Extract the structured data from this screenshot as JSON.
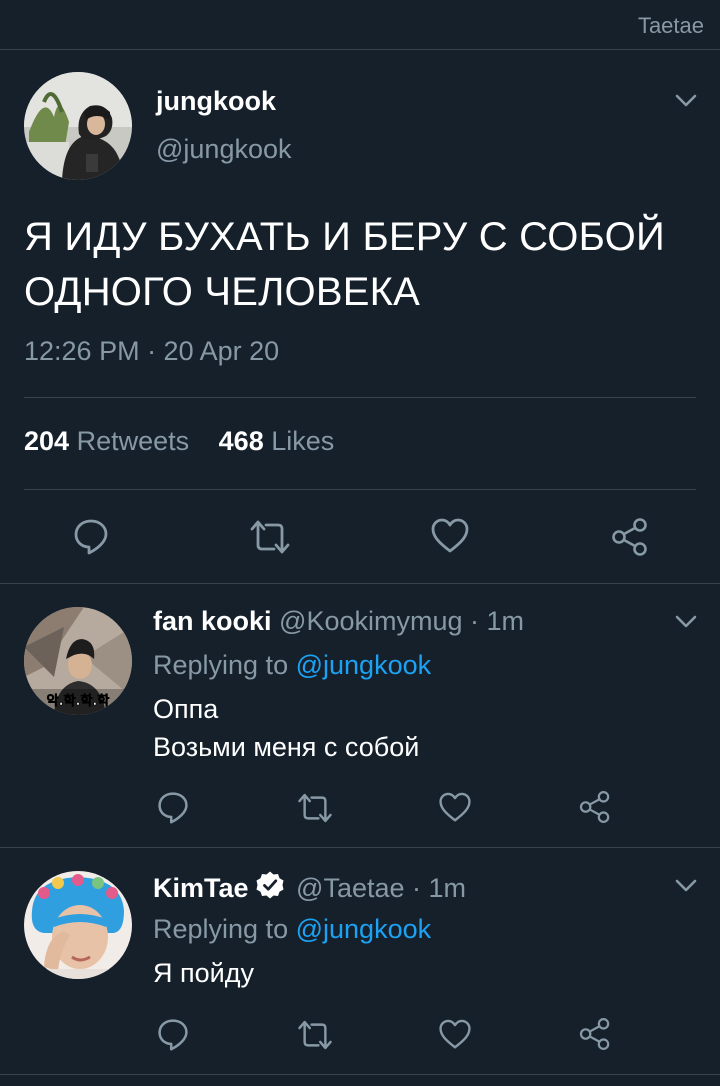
{
  "header": {
    "title": "Taetae"
  },
  "tweet": {
    "name": "jungkook",
    "handle": "@jungkook",
    "text_line1": "Я ИДУ БУХАТЬ И БЕРУ С СОБОЙ",
    "text_line2": "ОДНОГО ЧЕЛОВЕКА",
    "timestamp": "12:26 PM · 20 Apr 20",
    "retweets_count": "204",
    "retweets_label": "Retweets",
    "likes_count": "468",
    "likes_label": "Likes"
  },
  "replies": [
    {
      "name": "fan kooki",
      "handle": "@Kookimymug",
      "time": "· 1m",
      "replying_prefix": "Replying to",
      "replying_to": "@jungkook",
      "text_line1": "Оппа",
      "text_line2": "Возьми меня с собой",
      "avatar_text": "악.학.학.학"
    },
    {
      "name": "KimTae",
      "handle": "@Taetae",
      "time": "· 1m",
      "replying_prefix": "Replying to",
      "replying_to": "@jungkook",
      "text_line1": "Я пойду",
      "verified": true
    }
  ],
  "icons": {
    "reply": "reply-icon",
    "retweet": "retweet-icon",
    "like": "heart-icon",
    "share": "share-icon",
    "more": "chevron-down-icon"
  },
  "colors": {
    "background": "#15202b",
    "muted": "#8899a6",
    "link": "#1da1f2",
    "divider": "#38444d"
  }
}
